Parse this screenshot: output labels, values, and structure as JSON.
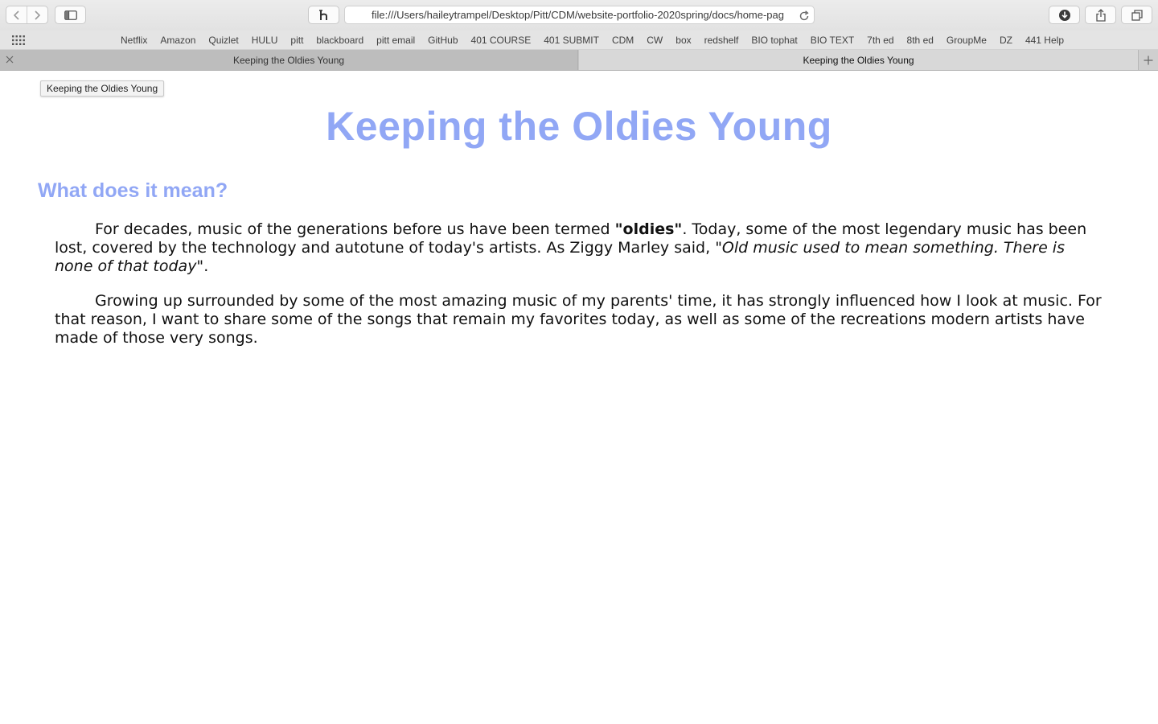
{
  "browser": {
    "address_url": "file:///Users/haileytrampel/Desktop/Pitt/CDM/website-portfolio-2020spring/docs/home-pag",
    "favorites": [
      "Netflix",
      "Amazon",
      "Quizlet",
      "HULU",
      "pitt",
      "blackboard",
      "pitt email",
      "GitHub",
      "401 COURSE",
      "401 SUBMIT",
      "CDM",
      "CW",
      "box",
      "redshelf",
      "BIO tophat",
      "BIO TEXT",
      "7th ed",
      "8th ed",
      "GroupMe",
      "DZ",
      "441 Help"
    ],
    "tabs": [
      {
        "label": "Keeping the Oldies Young",
        "active": false
      },
      {
        "label": "Keeping the Oldies Young",
        "active": true
      }
    ],
    "tooltip": "Keeping the Oldies Young"
  },
  "page": {
    "title": "Keeping the Oldies Young",
    "heading": "What does it mean?",
    "p1": {
      "t1": "For decades, music of the generations before us have been termed ",
      "bold": "\"oldies\"",
      "t2": ". Today, some of the most legendary music has been lost, covered by the technology and autotune of today's artists. As Ziggy Marley said, ",
      "quote": "\"Old music used to mean something. There is none of that today\"",
      "t3": "."
    },
    "p2": "Growing up surrounded by some of the most amazing music of my parents' time, it has strongly influenced how I look at music. For that reason, I want to share some of the songs that remain my favorites today, as well as some of the recreations modern artists have made of those very songs."
  },
  "colors": {
    "heading_accent": "#91a7f5"
  }
}
